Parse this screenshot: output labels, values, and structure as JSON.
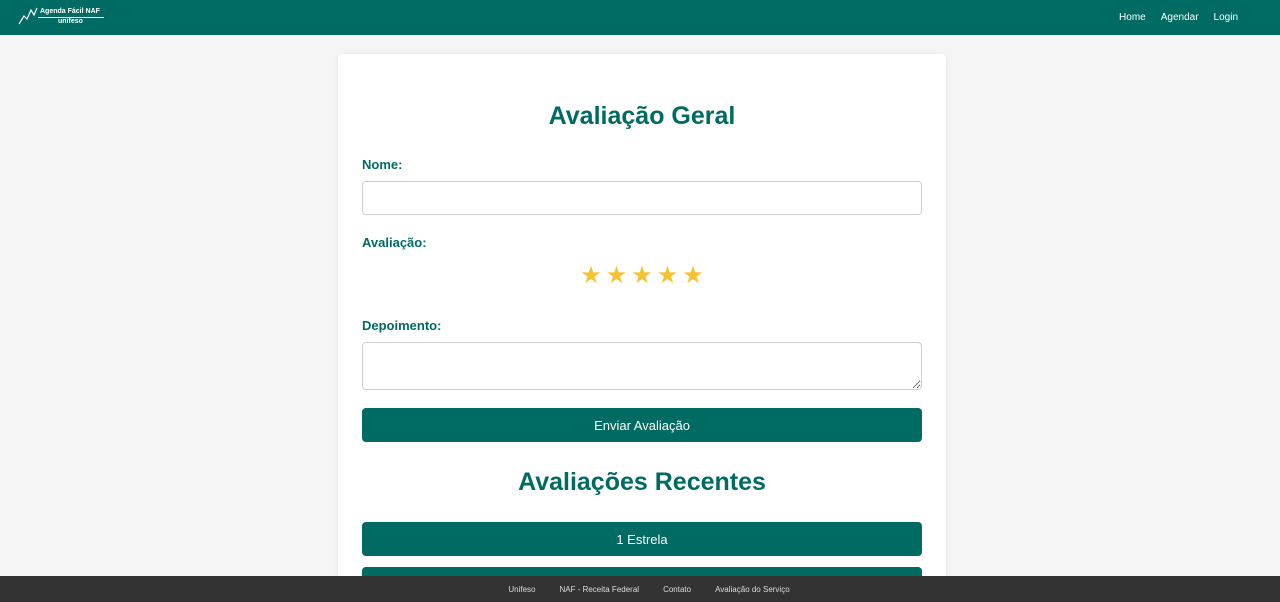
{
  "navbar": {
    "logo_line1": "Agenda Fácil NAF",
    "logo_line2": "unifeso",
    "links": [
      "Home",
      "Agendar",
      "Login"
    ]
  },
  "form": {
    "title": "Avaliação Geral",
    "name_label": "Nome:",
    "name_value": "",
    "rating_label": "Avaliação:",
    "stars": [
      "★",
      "★",
      "★",
      "★",
      "★"
    ],
    "testimony_label": "Depoimento:",
    "testimony_value": "",
    "submit_label": "Enviar Avaliação"
  },
  "recent": {
    "title": "Avaliações Recentes",
    "items": [
      "1 Estrela",
      ""
    ]
  },
  "footer": {
    "links": [
      "Unifeso",
      "NAF - Receita Federal",
      "Contato",
      "Avaliação do Serviço"
    ]
  },
  "colors": {
    "primary": "#006b63",
    "star": "#f4c430",
    "footer": "#333333",
    "background": "#f5f5f5"
  }
}
